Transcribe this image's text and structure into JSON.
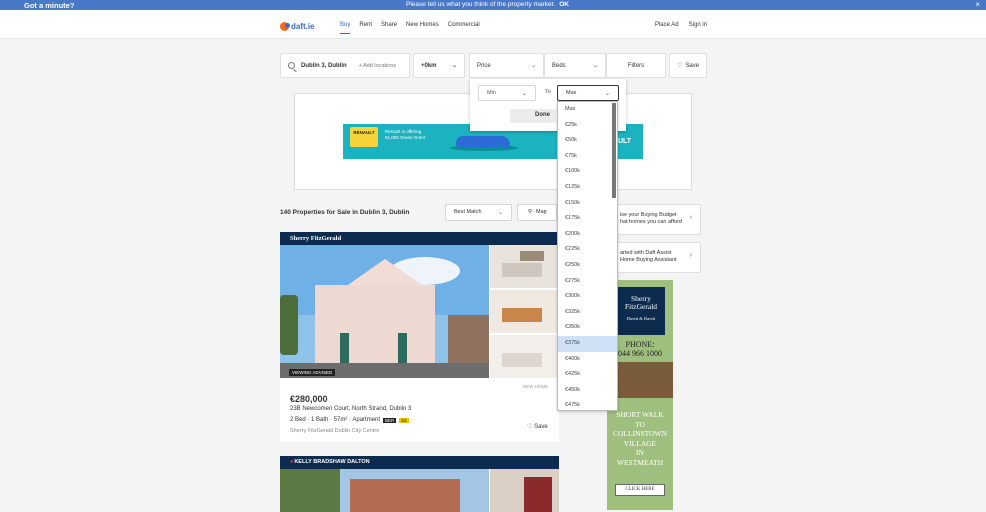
{
  "banner": {
    "title": "Got a minute?",
    "message": "Please tell us what you think of the property market.",
    "ok": "OK",
    "close": "×"
  },
  "header": {
    "logo": "daft.ie",
    "nav": [
      "Buy",
      "Rent",
      "Share",
      "New Homes",
      "Commercial"
    ],
    "place_ad": "Place Ad",
    "sign_in": "Sign in"
  },
  "filters": {
    "location": "Dublin 3, Dublin",
    "add_locations": "+ Add locations",
    "radius": "+0km",
    "price": "Price",
    "beds": "Beds",
    "filters": "Filters",
    "save": "Save"
  },
  "price_panel": {
    "min": "Min",
    "to": "To",
    "max": "Max",
    "done": "Done"
  },
  "price_options": [
    "Max",
    "€25k",
    "€50k",
    "€75k",
    "€100k",
    "€125k",
    "€150k",
    "€175k",
    "€200k",
    "€225k",
    "€250k",
    "€275k",
    "€300k",
    "€325k",
    "€350k",
    "€375k",
    "€400k",
    "€425k",
    "€450k",
    "€475k"
  ],
  "price_selected": "€375k",
  "advert": {
    "logo": "RENAULT",
    "copy_line1": "Renault is offering",
    "copy_line2": "€1,000 Green Grant",
    "right_text": "ULT"
  },
  "results": {
    "count": "140 Properties for Sale in Dublin 3, Dublin",
    "sort": "Best Match",
    "map": "Map"
  },
  "side_cards": [
    {
      "line1": "ise your Buying Budget",
      "line2": "hat homes you can afford"
    },
    {
      "line1": "arted with Daft Assist",
      "line2": "Home Buying Assistant"
    }
  ],
  "listing1": {
    "agent_brand": "Sherry FitzGerald",
    "tag": "VIEWING ADVISED",
    "status": "NEW HOME",
    "price": "€280,000",
    "address": "23B Newcomen Court, North Strand, Dublin 3",
    "meta": "2 Bed · 1 Bath · 57m² · Apartment",
    "ber_label": "BER",
    "ber_value": "D1",
    "agent": "Sherry FitzGerald Dublin City Centre",
    "save": "Save"
  },
  "listing2": {
    "agent_brand": "KELLY BRADSHAW DALTON"
  },
  "side_ad": {
    "brand_line1": "Sherry",
    "brand_line2": "FitzGerald",
    "brand_sub": "Davitt & Davitt",
    "phone_label": "PHONE:",
    "phone_number": "044 966 1000",
    "walk_lines": [
      "SHORT WALK",
      "TO",
      "COLLINSTOWN",
      "VILLAGE",
      "IN",
      "WESTMEATH"
    ],
    "cta": "CLICK HERE"
  },
  "colors": {
    "banner": "#4a78c8",
    "brand_blue": "#3a6bd1",
    "navy": "#0d2b4e",
    "selected_option": "#cfe1f7"
  }
}
